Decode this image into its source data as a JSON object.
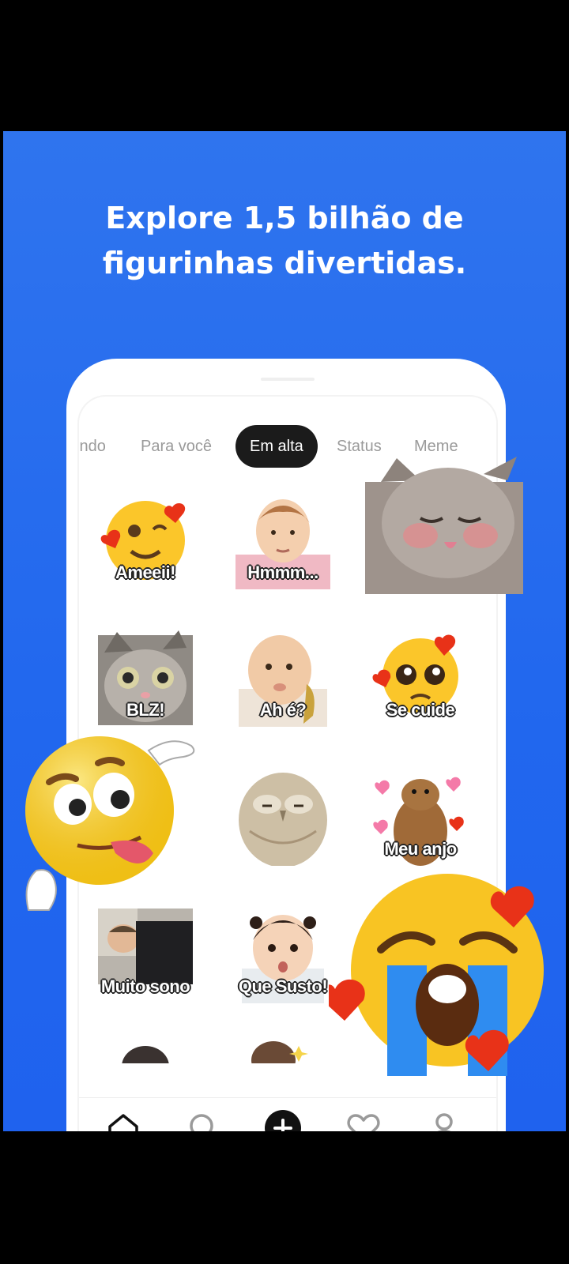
{
  "headline": {
    "line1": "Explore 1,5 bilhão de",
    "line2": "figurinhas divertidas."
  },
  "tabs": [
    {
      "label": "indo"
    },
    {
      "label": "Para você"
    },
    {
      "label": "Em alta",
      "active": true
    },
    {
      "label": "Status"
    },
    {
      "label": "Meme"
    }
  ],
  "stickers": [
    {
      "caption": "Ameeii!",
      "icon": "love-face-emoji-icon"
    },
    {
      "caption": "Hmmm...",
      "icon": "baby-photo"
    },
    {
      "caption": "",
      "icon": "cat-photo"
    },
    {
      "caption": "BLZ!",
      "icon": "cat-photo"
    },
    {
      "caption": "Ah é?",
      "icon": "baby-photo"
    },
    {
      "caption": "Se cuide",
      "icon": "pleading-face-emoji-icon"
    },
    {
      "caption": "",
      "icon": "silly-face-emoji-icon"
    },
    {
      "caption": "",
      "icon": "owl-photo"
    },
    {
      "caption": "Meu anjo",
      "icon": "prairie-dog-photo"
    },
    {
      "caption": "Muito sono",
      "icon": "sleeping-man-photo"
    },
    {
      "caption": "Que Susto!",
      "icon": "baby-photo"
    },
    {
      "caption": "",
      "icon": "crying-face-emoji-icon"
    }
  ],
  "navbar": [
    "home-icon",
    "search-icon",
    "add-icon",
    "favorites-icon",
    "profile-icon"
  ],
  "colors": {
    "background": "#2167ee",
    "active_tab": "#1b1b1b",
    "emoji": "#fbc62a",
    "heart": "#e83218"
  }
}
